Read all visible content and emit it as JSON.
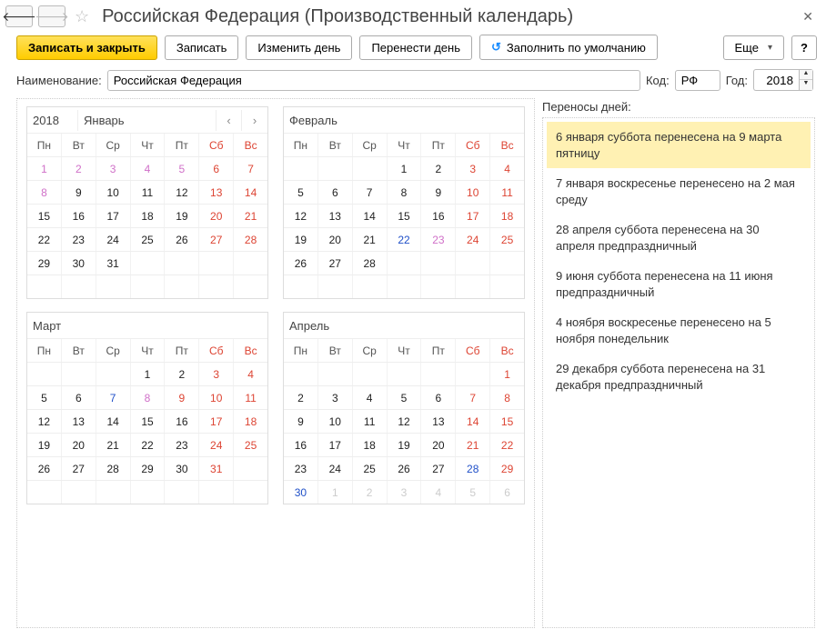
{
  "title": "Российская Федерация (Производственный календарь)",
  "toolbar": {
    "save_close": "Записать и закрыть",
    "save": "Записать",
    "change_day": "Изменить день",
    "move_day": "Перенести день",
    "fill_default": "Заполнить по умолчанию",
    "more": "Еще",
    "help": "?"
  },
  "form": {
    "name_label": "Наименование:",
    "name_value": "Российская Федерация",
    "code_label": "Код:",
    "code_value": "РФ",
    "year_label": "Год:",
    "year_value": "2018"
  },
  "side_label": "Переносы дней:",
  "transfers": [
    "6 января суббота перенесена на 9 марта пятницу",
    "7 января воскресенье перенесено на 2 мая среду",
    "28 апреля суббота перенесена на 30 апреля предпраздничный",
    "9 июня суббота перенесена на 11 июня предпраздничный",
    "4 ноября воскресенье перенесено на 5 ноября понедельник",
    "29 декабря суббота перенесена на 31 декабря предпраздничный"
  ],
  "year_cell": "2018",
  "dow": [
    "Пн",
    "Вт",
    "Ср",
    "Чт",
    "Пт",
    "Сб",
    "Вс"
  ],
  "months": [
    {
      "name": "Январь",
      "show_year_nav": true,
      "weeks": [
        [
          {
            "n": "1",
            "t": "hol"
          },
          {
            "n": "2",
            "t": "hol"
          },
          {
            "n": "3",
            "t": "hol"
          },
          {
            "n": "4",
            "t": "hol"
          },
          {
            "n": "5",
            "t": "hol"
          },
          {
            "n": "6",
            "t": "we"
          },
          {
            "n": "7",
            "t": "we"
          }
        ],
        [
          {
            "n": "8",
            "t": "hol"
          },
          {
            "n": "9",
            "t": ""
          },
          {
            "n": "10",
            "t": ""
          },
          {
            "n": "11",
            "t": ""
          },
          {
            "n": "12",
            "t": ""
          },
          {
            "n": "13",
            "t": "we"
          },
          {
            "n": "14",
            "t": "we"
          }
        ],
        [
          {
            "n": "15",
            "t": ""
          },
          {
            "n": "16",
            "t": ""
          },
          {
            "n": "17",
            "t": ""
          },
          {
            "n": "18",
            "t": ""
          },
          {
            "n": "19",
            "t": ""
          },
          {
            "n": "20",
            "t": "we"
          },
          {
            "n": "21",
            "t": "we"
          }
        ],
        [
          {
            "n": "22",
            "t": ""
          },
          {
            "n": "23",
            "t": ""
          },
          {
            "n": "24",
            "t": ""
          },
          {
            "n": "25",
            "t": ""
          },
          {
            "n": "26",
            "t": ""
          },
          {
            "n": "27",
            "t": "we"
          },
          {
            "n": "28",
            "t": "we"
          }
        ],
        [
          {
            "n": "29",
            "t": ""
          },
          {
            "n": "30",
            "t": ""
          },
          {
            "n": "31",
            "t": ""
          },
          {
            "n": "",
            "t": ""
          },
          {
            "n": "",
            "t": ""
          },
          {
            "n": "",
            "t": ""
          },
          {
            "n": "",
            "t": ""
          }
        ],
        [
          {
            "n": "",
            "t": ""
          },
          {
            "n": "",
            "t": ""
          },
          {
            "n": "",
            "t": ""
          },
          {
            "n": "",
            "t": ""
          },
          {
            "n": "",
            "t": ""
          },
          {
            "n": "",
            "t": ""
          },
          {
            "n": "",
            "t": ""
          }
        ]
      ]
    },
    {
      "name": "Февраль",
      "weeks": [
        [
          {
            "n": "",
            "t": ""
          },
          {
            "n": "",
            "t": ""
          },
          {
            "n": "",
            "t": ""
          },
          {
            "n": "1",
            "t": ""
          },
          {
            "n": "2",
            "t": ""
          },
          {
            "n": "3",
            "t": "we"
          },
          {
            "n": "4",
            "t": "we"
          }
        ],
        [
          {
            "n": "5",
            "t": ""
          },
          {
            "n": "6",
            "t": ""
          },
          {
            "n": "7",
            "t": ""
          },
          {
            "n": "8",
            "t": ""
          },
          {
            "n": "9",
            "t": ""
          },
          {
            "n": "10",
            "t": "we"
          },
          {
            "n": "11",
            "t": "we"
          }
        ],
        [
          {
            "n": "12",
            "t": ""
          },
          {
            "n": "13",
            "t": ""
          },
          {
            "n": "14",
            "t": ""
          },
          {
            "n": "15",
            "t": ""
          },
          {
            "n": "16",
            "t": ""
          },
          {
            "n": "17",
            "t": "we"
          },
          {
            "n": "18",
            "t": "we"
          }
        ],
        [
          {
            "n": "19",
            "t": ""
          },
          {
            "n": "20",
            "t": ""
          },
          {
            "n": "21",
            "t": ""
          },
          {
            "n": "22",
            "t": "pre"
          },
          {
            "n": "23",
            "t": "hol"
          },
          {
            "n": "24",
            "t": "we"
          },
          {
            "n": "25",
            "t": "we"
          }
        ],
        [
          {
            "n": "26",
            "t": ""
          },
          {
            "n": "27",
            "t": ""
          },
          {
            "n": "28",
            "t": ""
          },
          {
            "n": "",
            "t": ""
          },
          {
            "n": "",
            "t": ""
          },
          {
            "n": "",
            "t": ""
          },
          {
            "n": "",
            "t": ""
          }
        ],
        [
          {
            "n": "",
            "t": ""
          },
          {
            "n": "",
            "t": ""
          },
          {
            "n": "",
            "t": ""
          },
          {
            "n": "",
            "t": ""
          },
          {
            "n": "",
            "t": ""
          },
          {
            "n": "",
            "t": ""
          },
          {
            "n": "",
            "t": ""
          }
        ]
      ]
    },
    {
      "name": "Март",
      "weeks": [
        [
          {
            "n": "",
            "t": ""
          },
          {
            "n": "",
            "t": ""
          },
          {
            "n": "",
            "t": ""
          },
          {
            "n": "1",
            "t": ""
          },
          {
            "n": "2",
            "t": ""
          },
          {
            "n": "3",
            "t": "we"
          },
          {
            "n": "4",
            "t": "we"
          }
        ],
        [
          {
            "n": "5",
            "t": ""
          },
          {
            "n": "6",
            "t": ""
          },
          {
            "n": "7",
            "t": "pre"
          },
          {
            "n": "8",
            "t": "hol"
          },
          {
            "n": "9",
            "t": "we"
          },
          {
            "n": "10",
            "t": "we"
          },
          {
            "n": "11",
            "t": "we"
          }
        ],
        [
          {
            "n": "12",
            "t": ""
          },
          {
            "n": "13",
            "t": ""
          },
          {
            "n": "14",
            "t": ""
          },
          {
            "n": "15",
            "t": ""
          },
          {
            "n": "16",
            "t": ""
          },
          {
            "n": "17",
            "t": "we"
          },
          {
            "n": "18",
            "t": "we"
          }
        ],
        [
          {
            "n": "19",
            "t": ""
          },
          {
            "n": "20",
            "t": ""
          },
          {
            "n": "21",
            "t": ""
          },
          {
            "n": "22",
            "t": ""
          },
          {
            "n": "23",
            "t": ""
          },
          {
            "n": "24",
            "t": "we"
          },
          {
            "n": "25",
            "t": "we"
          }
        ],
        [
          {
            "n": "26",
            "t": ""
          },
          {
            "n": "27",
            "t": ""
          },
          {
            "n": "28",
            "t": ""
          },
          {
            "n": "29",
            "t": ""
          },
          {
            "n": "30",
            "t": ""
          },
          {
            "n": "31",
            "t": "we"
          },
          {
            "n": "",
            "t": ""
          }
        ],
        [
          {
            "n": "",
            "t": ""
          },
          {
            "n": "",
            "t": ""
          },
          {
            "n": "",
            "t": ""
          },
          {
            "n": "",
            "t": ""
          },
          {
            "n": "",
            "t": ""
          },
          {
            "n": "",
            "t": ""
          },
          {
            "n": "",
            "t": ""
          }
        ]
      ]
    },
    {
      "name": "Апрель",
      "weeks": [
        [
          {
            "n": "",
            "t": ""
          },
          {
            "n": "",
            "t": ""
          },
          {
            "n": "",
            "t": ""
          },
          {
            "n": "",
            "t": ""
          },
          {
            "n": "",
            "t": ""
          },
          {
            "n": "",
            "t": ""
          },
          {
            "n": "1",
            "t": "we"
          }
        ],
        [
          {
            "n": "2",
            "t": ""
          },
          {
            "n": "3",
            "t": ""
          },
          {
            "n": "4",
            "t": ""
          },
          {
            "n": "5",
            "t": ""
          },
          {
            "n": "6",
            "t": ""
          },
          {
            "n": "7",
            "t": "we"
          },
          {
            "n": "8",
            "t": "we"
          }
        ],
        [
          {
            "n": "9",
            "t": ""
          },
          {
            "n": "10",
            "t": ""
          },
          {
            "n": "11",
            "t": ""
          },
          {
            "n": "12",
            "t": ""
          },
          {
            "n": "13",
            "t": ""
          },
          {
            "n": "14",
            "t": "we"
          },
          {
            "n": "15",
            "t": "we"
          }
        ],
        [
          {
            "n": "16",
            "t": ""
          },
          {
            "n": "17",
            "t": ""
          },
          {
            "n": "18",
            "t": ""
          },
          {
            "n": "19",
            "t": ""
          },
          {
            "n": "20",
            "t": ""
          },
          {
            "n": "21",
            "t": "we"
          },
          {
            "n": "22",
            "t": "we"
          }
        ],
        [
          {
            "n": "23",
            "t": ""
          },
          {
            "n": "24",
            "t": ""
          },
          {
            "n": "25",
            "t": ""
          },
          {
            "n": "26",
            "t": ""
          },
          {
            "n": "27",
            "t": ""
          },
          {
            "n": "28",
            "t": "pre"
          },
          {
            "n": "29",
            "t": "we"
          }
        ],
        [
          {
            "n": "30",
            "t": "pre"
          },
          {
            "n": "1",
            "t": "oth"
          },
          {
            "n": "2",
            "t": "oth"
          },
          {
            "n": "3",
            "t": "oth"
          },
          {
            "n": "4",
            "t": "oth"
          },
          {
            "n": "5",
            "t": "oth"
          },
          {
            "n": "6",
            "t": "oth"
          }
        ]
      ]
    }
  ]
}
